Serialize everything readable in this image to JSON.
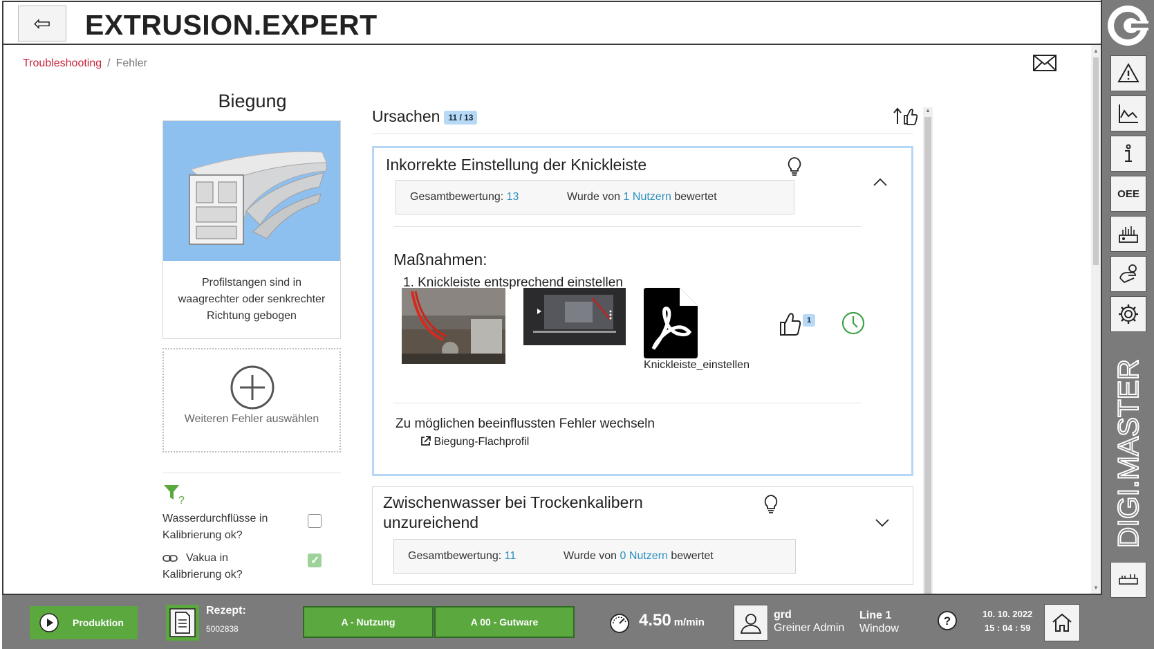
{
  "header": {
    "back_label": "⇦",
    "title": "EXTRUSION.EXPERT"
  },
  "breadcrumb": {
    "root": "Troubleshooting",
    "separator": "/",
    "current": "Fehler"
  },
  "error": {
    "title": "Biegung",
    "description": "Profilstangen sind in waagrechter oder senkrechter Richtung gebogen",
    "add_label": "Weiteren Fehler auswählen"
  },
  "checks": [
    {
      "label": "Wasserdurchflüsse in Kalibrierung ok?",
      "checked": false
    },
    {
      "label": "Vakua in Kalibrierung ok?",
      "checked": true
    }
  ],
  "causes": {
    "title": "Ursachen",
    "count": "11 / 13",
    "items": [
      {
        "title": "Inkorrekte Einstellung der Knickleiste",
        "score_label": "Gesamtbewertung:",
        "score": "13",
        "rated_prefix": "Wurde von",
        "rated_count": "1",
        "rated_users": "Nutzern",
        "rated_suffix": "bewertet",
        "measures_title": "Maßnahmen:",
        "step": "1. Knickleiste entsprechend einstellen",
        "pdf_name": "Knickleiste_einstellen",
        "likes": "1",
        "switch_text": "Zu möglichen beeinflussten Fehler wechseln",
        "switch_link": "Biegung-Flachprofil"
      },
      {
        "title_line1": "Zwischenwasser bei Trockenkalibern",
        "title_line2": "unzureichend",
        "score_label": "Gesamtbewertung:",
        "score": "11",
        "rated_prefix": "Wurde von",
        "rated_count": "0",
        "rated_users": "Nutzern",
        "rated_suffix": "bewertet"
      }
    ]
  },
  "footer": {
    "mode": "Produktion",
    "recipe_label": "Rezept:",
    "recipe_value": "5002838",
    "usage": "A - Nutzung",
    "quality": "A 00 - Gutware",
    "speed": "4.50",
    "speed_unit": "m/min",
    "user": "grd",
    "role": "Greiner Admin",
    "line": "Line 1",
    "window": "Window",
    "date": "10. 10. 2022",
    "time": "15 : 04 : 59"
  },
  "sidebar": {
    "brand": "DIGI.MASTER",
    "oee_label": "OEE",
    "icons": [
      "alert-icon",
      "chart-icon",
      "info-icon",
      "oee-icon",
      "machine-icon",
      "maintenance-icon",
      "settings-icon",
      "line-overview-icon"
    ]
  },
  "colors": {
    "accent_green": "#5aa83e",
    "link_red": "#c4243a",
    "link_blue": "#2b8fbf",
    "badge_blue": "#b7d9f5"
  }
}
